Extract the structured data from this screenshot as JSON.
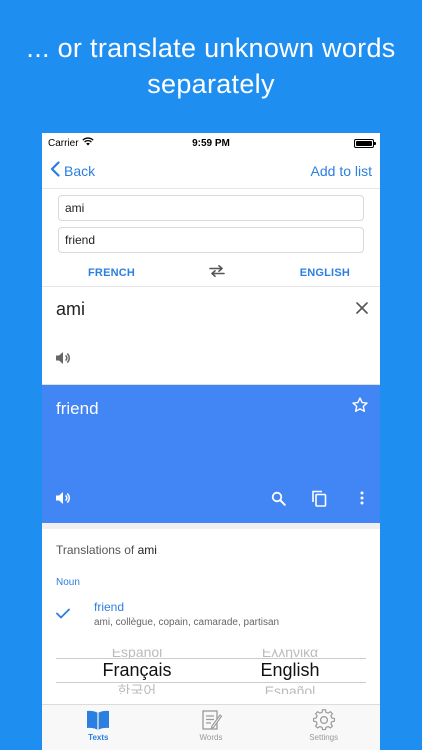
{
  "headline": {
    "line1": "... or translate unknown words",
    "line2": "separately"
  },
  "status_bar": {
    "carrier": "Carrier",
    "time": "9:59 PM"
  },
  "nav": {
    "back_label": "Back",
    "add_label": "Add to list"
  },
  "fields": {
    "source_word": "ami",
    "target_word": "friend"
  },
  "languages": {
    "from": "FRENCH",
    "to": "ENGLISH"
  },
  "source_panel": {
    "text": "ami"
  },
  "output_panel": {
    "text": "friend"
  },
  "dictionary": {
    "heading_prefix": "Translations of",
    "heading_word": "ami",
    "part_of_speech": "Noun",
    "entries": [
      {
        "word": "friend",
        "synonyms": "ami, collègue, copain, camarade, partisan"
      }
    ]
  },
  "picker": {
    "left": {
      "above": "Español",
      "selected": "Français",
      "below": "한국어"
    },
    "right": {
      "above": "Ελληνικά",
      "selected": "English",
      "below": "Español"
    }
  },
  "tabs": [
    {
      "label": "Texts",
      "icon": "book-icon",
      "active": true
    },
    {
      "label": "Words",
      "icon": "notepad-icon",
      "active": false
    },
    {
      "label": "Settings",
      "icon": "gear-icon",
      "active": false
    }
  ],
  "colors": {
    "background": "#1f8ef1",
    "accent": "#2b7fe0",
    "output_panel": "#4285f4"
  }
}
